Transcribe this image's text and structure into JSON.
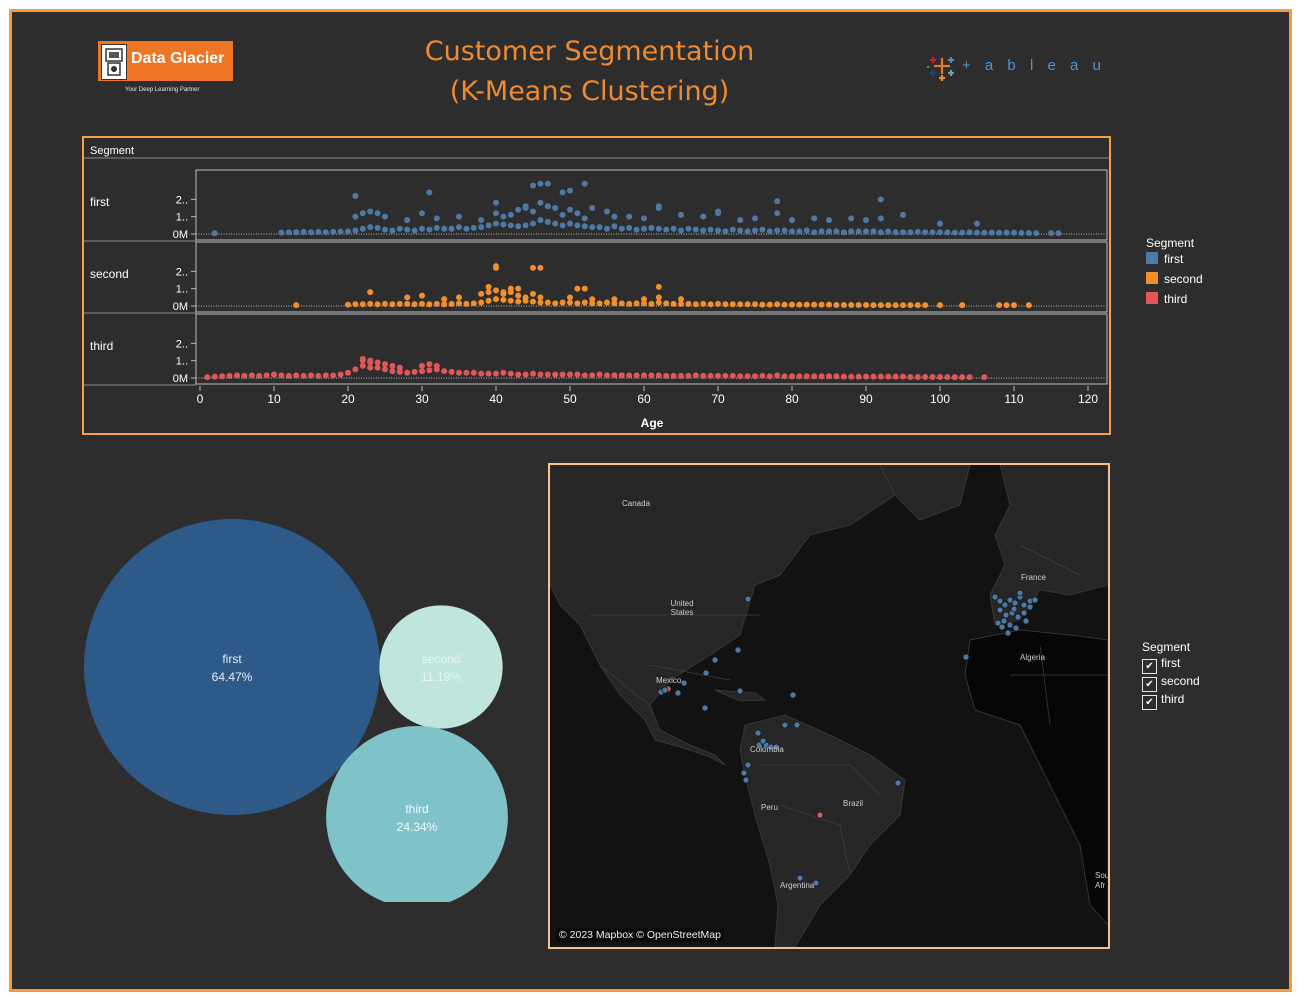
{
  "header": {
    "brand_name": "Data Glacier",
    "brand_tagline": "Your Deep Learning Partner",
    "title_line1": "Customer Segmentation",
    "title_line2": "(K-Means Clustering)",
    "tableau_wordmark": "+ a b l e a u",
    "tableau_icon": "tableau-plus-cluster-icon"
  },
  "colors": {
    "first": "#4e79a7",
    "second": "#f28e2b",
    "third": "#e15759",
    "accent": "#f59a3e",
    "background": "#2d2d2d",
    "bubble_first": "#2e5a8a",
    "bubble_second": "#bfe5dd",
    "bubble_third": "#7fc3c9"
  },
  "chart_data": [
    {
      "type": "scatter",
      "title": "",
      "row_header": "Segment",
      "rows": [
        "first",
        "second",
        "third"
      ],
      "xlabel": "Age",
      "xlim": [
        0,
        120
      ],
      "x_ticks": [
        0,
        10,
        20,
        30,
        40,
        50,
        60,
        70,
        80,
        90,
        100,
        110,
        120
      ],
      "y_tick_labels": [
        "2..",
        "1..",
        "0M"
      ],
      "ylim": [
        0,
        3
      ],
      "series": [
        {
          "name": "first",
          "x": [
            2,
            11,
            12,
            13,
            14,
            15,
            16,
            17,
            18,
            19,
            20,
            21,
            22,
            23,
            24,
            25,
            26,
            27,
            28,
            29,
            30,
            31,
            32,
            33,
            34,
            35,
            36,
            37,
            38,
            39,
            40,
            41,
            42,
            43,
            44,
            45,
            46,
            47,
            48,
            49,
            50,
            51,
            52,
            53,
            54,
            55,
            56,
            57,
            58,
            59,
            60,
            61,
            62,
            63,
            64,
            65,
            66,
            67,
            68,
            69,
            70,
            71,
            72,
            73,
            74,
            75,
            76,
            77,
            78,
            79,
            80,
            81,
            82,
            83,
            84,
            85,
            86,
            87,
            88,
            89,
            90,
            91,
            92,
            93,
            94,
            95,
            96,
            97,
            98,
            99,
            100,
            101,
            102,
            103,
            104,
            105,
            106,
            107,
            108,
            109,
            110,
            111,
            112,
            113,
            115,
            116,
            21,
            22,
            23,
            24,
            25,
            28,
            30,
            32,
            35,
            38,
            40,
            41,
            42,
            43,
            44,
            45,
            46,
            47,
            48,
            49,
            50,
            51,
            52,
            53,
            55,
            56,
            58,
            60,
            62,
            65,
            68,
            70,
            73,
            75,
            78,
            80,
            83,
            85,
            88,
            90,
            92,
            100,
            105,
            21,
            31,
            45,
            46,
            47,
            49,
            50,
            52,
            40,
            44,
            78,
            92,
            62,
            70,
            95
          ],
          "values": [
            0.05,
            0.08,
            0.1,
            0.1,
            0.12,
            0.1,
            0.12,
            0.1,
            0.12,
            0.14,
            0.15,
            0.2,
            0.3,
            0.4,
            0.35,
            0.25,
            0.2,
            0.3,
            0.25,
            0.2,
            0.3,
            0.25,
            0.35,
            0.3,
            0.3,
            0.4,
            0.3,
            0.35,
            0.4,
            0.5,
            0.6,
            0.55,
            0.5,
            0.45,
            0.5,
            0.6,
            0.8,
            0.7,
            0.6,
            0.5,
            0.6,
            0.5,
            0.45,
            0.4,
            0.4,
            0.3,
            0.45,
            0.3,
            0.35,
            0.25,
            0.3,
            0.35,
            0.3,
            0.25,
            0.3,
            0.2,
            0.3,
            0.25,
            0.2,
            0.25,
            0.2,
            0.15,
            0.25,
            0.2,
            0.15,
            0.2,
            0.25,
            0.15,
            0.2,
            0.2,
            0.15,
            0.15,
            0.2,
            0.1,
            0.15,
            0.15,
            0.15,
            0.1,
            0.15,
            0.15,
            0.15,
            0.15,
            0.1,
            0.15,
            0.1,
            0.1,
            0.1,
            0.12,
            0.1,
            0.1,
            0.1,
            0.1,
            0.08,
            0.08,
            0.1,
            0.08,
            0.08,
            0.08,
            0.08,
            0.08,
            0.08,
            0.06,
            0.06,
            0.05,
            0.05,
            0.05,
            1.0,
            1.2,
            1.3,
            1.2,
            1.0,
            0.8,
            1.2,
            0.9,
            1.0,
            0.8,
            1.2,
            1.0,
            1.1,
            1.4,
            1.5,
            1.3,
            1.8,
            1.6,
            1.5,
            1.1,
            1.4,
            1.2,
            0.9,
            1.5,
            1.3,
            1.0,
            1.0,
            0.9,
            1.5,
            1.1,
            1.0,
            1.2,
            0.8,
            0.9,
            1.2,
            0.8,
            0.9,
            0.8,
            0.9,
            0.8,
            0.9,
            0.6,
            0.6,
            2.2,
            2.4,
            2.8,
            2.9,
            2.9,
            2.4,
            2.5,
            2.9,
            1.8,
            1.6,
            1.9,
            2.0,
            1.6,
            1.3,
            1.1
          ]
        },
        {
          "name": "second",
          "x": [
            13,
            20,
            21,
            22,
            23,
            24,
            25,
            26,
            27,
            28,
            29,
            30,
            31,
            32,
            33,
            34,
            35,
            36,
            37,
            38,
            39,
            40,
            41,
            42,
            43,
            44,
            45,
            46,
            47,
            48,
            49,
            50,
            51,
            52,
            53,
            54,
            55,
            56,
            57,
            58,
            59,
            60,
            61,
            62,
            63,
            64,
            65,
            66,
            67,
            68,
            69,
            70,
            71,
            72,
            73,
            74,
            75,
            76,
            77,
            78,
            79,
            80,
            81,
            82,
            83,
            84,
            85,
            86,
            87,
            88,
            89,
            90,
            91,
            92,
            93,
            94,
            95,
            96,
            97,
            98,
            100,
            103,
            108,
            109,
            110,
            112,
            23,
            28,
            30,
            33,
            35,
            38,
            39,
            40,
            41,
            42,
            43,
            44,
            45,
            46,
            50,
            53,
            56,
            60,
            62,
            65,
            40,
            40,
            42,
            43,
            45,
            46,
            51,
            52,
            62,
            39,
            41
          ],
          "values": [
            0.05,
            0.08,
            0.1,
            0.1,
            0.12,
            0.1,
            0.12,
            0.1,
            0.12,
            0.12,
            0.1,
            0.12,
            0.1,
            0.12,
            0.1,
            0.12,
            0.15,
            0.12,
            0.15,
            0.2,
            0.3,
            0.4,
            0.35,
            0.3,
            0.25,
            0.3,
            0.25,
            0.2,
            0.2,
            0.15,
            0.2,
            0.2,
            0.15,
            0.2,
            0.15,
            0.15,
            0.2,
            0.15,
            0.15,
            0.12,
            0.15,
            0.15,
            0.12,
            0.2,
            0.15,
            0.12,
            0.12,
            0.12,
            0.1,
            0.12,
            0.1,
            0.12,
            0.1,
            0.1,
            0.1,
            0.1,
            0.1,
            0.08,
            0.08,
            0.1,
            0.08,
            0.08,
            0.08,
            0.08,
            0.08,
            0.08,
            0.08,
            0.06,
            0.06,
            0.06,
            0.06,
            0.06,
            0.05,
            0.05,
            0.05,
            0.05,
            0.05,
            0.05,
            0.05,
            0.05,
            0.05,
            0.05,
            0.05,
            0.05,
            0.05,
            0.05,
            0.8,
            0.5,
            0.6,
            0.4,
            0.5,
            0.7,
            0.8,
            0.9,
            0.7,
            0.8,
            0.6,
            0.5,
            0.7,
            0.5,
            0.5,
            0.4,
            0.4,
            0.4,
            0.5,
            0.4,
            2.3,
            2.2,
            1.0,
            1.0,
            2.2,
            2.2,
            1.0,
            1.0,
            1.1,
            1.1,
            0.8
          ]
        },
        {
          "name": "third",
          "x": [
            1,
            2,
            3,
            4,
            5,
            6,
            7,
            8,
            9,
            10,
            11,
            12,
            13,
            14,
            15,
            16,
            17,
            18,
            19,
            20,
            21,
            22,
            23,
            24,
            25,
            26,
            27,
            28,
            29,
            30,
            31,
            32,
            33,
            34,
            35,
            36,
            37,
            38,
            39,
            40,
            41,
            42,
            43,
            44,
            45,
            46,
            47,
            48,
            49,
            50,
            51,
            52,
            53,
            54,
            55,
            56,
            57,
            58,
            59,
            60,
            61,
            62,
            63,
            64,
            65,
            66,
            67,
            68,
            69,
            70,
            71,
            72,
            73,
            74,
            75,
            76,
            77,
            78,
            79,
            80,
            81,
            82,
            83,
            84,
            85,
            86,
            87,
            88,
            89,
            90,
            91,
            92,
            93,
            94,
            95,
            96,
            97,
            98,
            99,
            100,
            101,
            102,
            103,
            104,
            106,
            22,
            23,
            24,
            25,
            26,
            27,
            30,
            31,
            32,
            22,
            23
          ],
          "values": [
            0.05,
            0.08,
            0.1,
            0.12,
            0.15,
            0.12,
            0.15,
            0.12,
            0.15,
            0.2,
            0.15,
            0.12,
            0.15,
            0.12,
            0.15,
            0.12,
            0.15,
            0.15,
            0.2,
            0.3,
            0.5,
            0.7,
            0.6,
            0.6,
            0.5,
            0.4,
            0.35,
            0.3,
            0.35,
            0.4,
            0.45,
            0.5,
            0.4,
            0.35,
            0.3,
            0.3,
            0.3,
            0.25,
            0.25,
            0.25,
            0.3,
            0.25,
            0.2,
            0.2,
            0.25,
            0.2,
            0.2,
            0.2,
            0.2,
            0.2,
            0.2,
            0.15,
            0.15,
            0.2,
            0.15,
            0.15,
            0.15,
            0.15,
            0.15,
            0.15,
            0.15,
            0.15,
            0.12,
            0.12,
            0.12,
            0.12,
            0.15,
            0.12,
            0.12,
            0.12,
            0.12,
            0.12,
            0.1,
            0.1,
            0.1,
            0.12,
            0.1,
            0.15,
            0.1,
            0.1,
            0.1,
            0.1,
            0.1,
            0.1,
            0.1,
            0.1,
            0.08,
            0.08,
            0.08,
            0.08,
            0.08,
            0.08,
            0.08,
            0.08,
            0.08,
            0.06,
            0.06,
            0.06,
            0.06,
            0.06,
            0.05,
            0.05,
            0.05,
            0.05,
            0.05,
            1.1,
            1.0,
            0.9,
            0.8,
            0.7,
            0.6,
            0.7,
            0.8,
            0.7,
            1.0,
            0.9
          ]
        }
      ],
      "legend": {
        "title": "Segment",
        "placement": "right",
        "items": [
          "first",
          "second",
          "third"
        ]
      }
    },
    {
      "type": "bubble",
      "categories": [
        "first",
        "second",
        "third"
      ],
      "values": [
        64.47,
        11.19,
        24.34
      ],
      "labels": [
        "64.47%",
        "11.19%",
        "24.34%"
      ]
    }
  ],
  "map": {
    "credit": "© 2023 Mapbox © OpenStreetMap",
    "labels": [
      "Canada",
      "United States",
      "Mexico",
      "Colombia",
      "Peru",
      "Brazil",
      "Argentina",
      "France",
      "Algeria",
      "Sou",
      "Afr"
    ]
  },
  "filter": {
    "title": "Segment",
    "items": [
      {
        "label": "first",
        "checked": true
      },
      {
        "label": "second",
        "checked": true
      },
      {
        "label": "third",
        "checked": true
      }
    ],
    "check_glyph": "✔"
  }
}
